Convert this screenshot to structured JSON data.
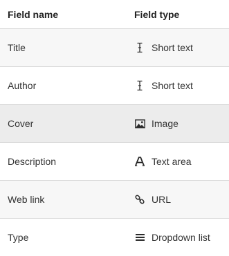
{
  "header": {
    "field_name": "Field name",
    "field_type": "Field type"
  },
  "rows": [
    {
      "name": "Title",
      "type": "Short text",
      "icon": "text-cursor-icon"
    },
    {
      "name": "Author",
      "type": "Short text",
      "icon": "text-cursor-icon"
    },
    {
      "name": "Cover",
      "type": "Image",
      "icon": "image-icon"
    },
    {
      "name": "Description",
      "type": "Text area",
      "icon": "text-area-icon"
    },
    {
      "name": "Web link",
      "type": "URL",
      "icon": "link-icon"
    },
    {
      "name": "Type",
      "type": "Dropdown list",
      "icon": "list-icon"
    }
  ],
  "colors": {
    "row_alt": "#f7f7f7",
    "row_highlight": "#ececec",
    "divider": "#dcdcdc"
  }
}
